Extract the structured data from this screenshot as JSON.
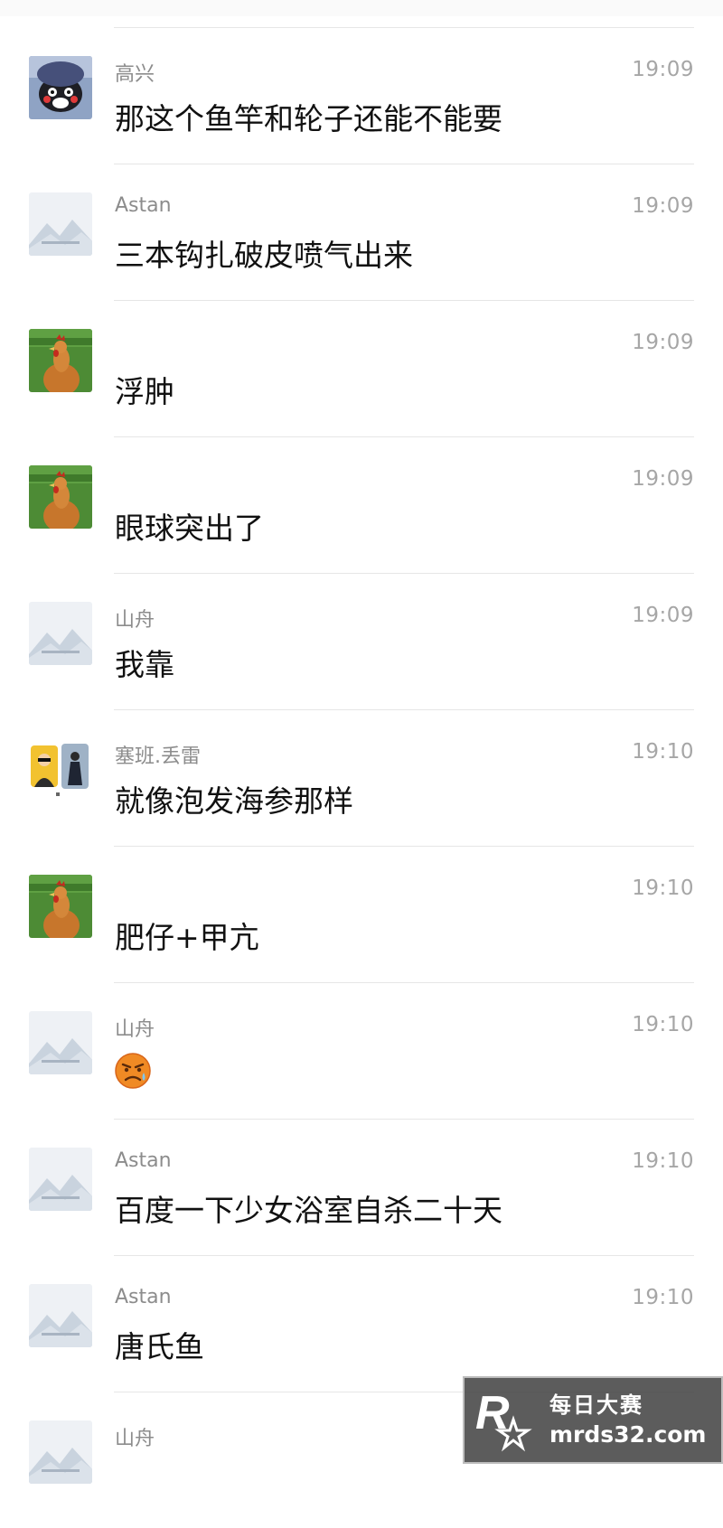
{
  "messages": [
    {
      "avatar": "kumamon-avatar",
      "name": "高兴",
      "time": "19:09",
      "text": "那这个鱼竿和轮子还能不能要"
    },
    {
      "avatar": "placeholder-avatar",
      "name": "Astan",
      "time": "19:09",
      "text": "三本钩扎破皮喷气出来"
    },
    {
      "avatar": "rooster-avatar",
      "name": "",
      "time": "19:09",
      "text": "浮肿"
    },
    {
      "avatar": "rooster-avatar",
      "name": "",
      "time": "19:09",
      "text": "眼球突出了"
    },
    {
      "avatar": "placeholder-avatar",
      "name": "山舟",
      "time": "19:09",
      "text": "我靠"
    },
    {
      "avatar": "group-avatar",
      "name": "塞班.丢雷",
      "time": "19:10",
      "text": "就像泡发海参那样"
    },
    {
      "avatar": "rooster-avatar",
      "name": "",
      "time": "19:10",
      "text": "肥仔+甲亢"
    },
    {
      "avatar": "placeholder-avatar",
      "name": "山舟",
      "time": "19:10",
      "text": "",
      "emoji": "awkward-face-emoji"
    },
    {
      "avatar": "placeholder-avatar",
      "name": "Astan",
      "time": "19:10",
      "text": "百度一下少女浴室自杀二十天"
    },
    {
      "avatar": "placeholder-avatar",
      "name": "Astan",
      "time": "19:10",
      "text": "唐氏鱼"
    },
    {
      "avatar": "placeholder-avatar",
      "name": "山舟",
      "time": "",
      "text": ""
    }
  ],
  "watermark": {
    "title": "每日大赛",
    "url": "mrds32.com",
    "logo": "R"
  },
  "colors": {
    "name": "#8c8c8c",
    "time": "#a6a6a6",
    "text": "#111111",
    "divider": "#e6e6e6"
  }
}
